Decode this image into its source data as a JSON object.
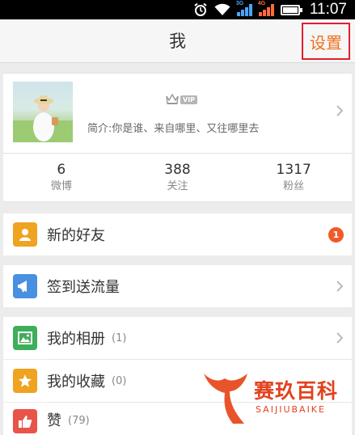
{
  "status_bar": {
    "time": "11:07",
    "icons": [
      "alarm-icon",
      "wifi-icon",
      "signal-3g-icon",
      "signal-4g-icon",
      "battery-icon"
    ]
  },
  "header": {
    "title": "我",
    "settings_label": "设置"
  },
  "profile": {
    "vip_label": "VIP",
    "bio": "简介:你是谁、来自哪里、又往哪里去"
  },
  "stats": [
    {
      "value": "6",
      "label": "微博"
    },
    {
      "value": "388",
      "label": "关注"
    },
    {
      "value": "1317",
      "label": "粉丝"
    }
  ],
  "menu": {
    "new_friends": {
      "label": "新的好友",
      "badge": "1",
      "icon": "person-icon",
      "color": "#f0a320"
    },
    "checkin": {
      "label": "签到送流量",
      "icon": "megaphone-icon",
      "color": "#4a90e2"
    },
    "album": {
      "label": "我的相册",
      "count": "(1)",
      "icon": "photo-icon",
      "color": "#3fae5b"
    },
    "favorites": {
      "label": "我的收藏",
      "count": "(0)",
      "icon": "star-icon",
      "color": "#f0a320"
    },
    "likes": {
      "label": "赞",
      "count": "(79)",
      "icon": "thumbs-up-icon",
      "color": "#e8544a"
    }
  },
  "watermark": {
    "text": "赛玖百科",
    "sub": "SAIJIUBAIKE"
  }
}
